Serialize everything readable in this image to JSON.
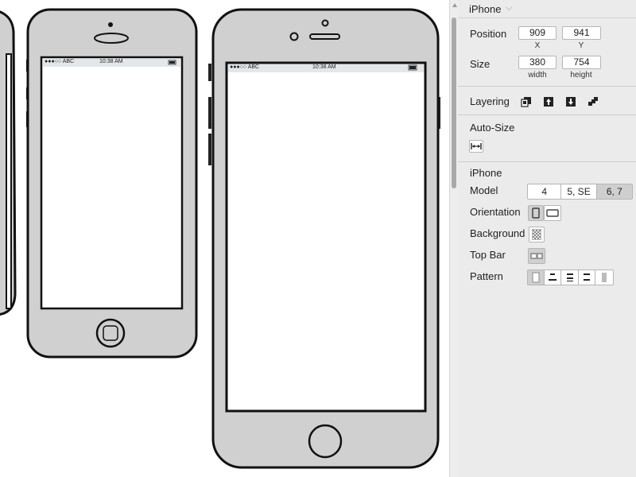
{
  "canvas": {
    "phone_small": {
      "carrier": "●●●○○ ABC",
      "time": "10:38 AM"
    },
    "phone_large": {
      "carrier": "●●●○○ ABC",
      "time": "10:38 AM"
    }
  },
  "panel": {
    "title": "iPhone",
    "position": {
      "label": "Position",
      "x": "909",
      "y": "941",
      "x_caption": "X",
      "y_caption": "Y"
    },
    "size": {
      "label": "Size",
      "width": "380",
      "height": "754",
      "width_caption": "width",
      "height_caption": "height"
    },
    "layering": {
      "label": "Layering",
      "icons": [
        "bring-to-front-icon",
        "bring-forward-icon",
        "send-backward-icon",
        "send-to-back-icon"
      ]
    },
    "autosize": {
      "label": "Auto-Size",
      "icon": "fit-width-icon"
    },
    "section_title": "iPhone",
    "model": {
      "label": "Model",
      "options": [
        "4",
        "5, SE",
        "6, 7"
      ],
      "selected": "6, 7"
    },
    "orientation": {
      "label": "Orientation",
      "options": [
        "portrait",
        "landscape"
      ],
      "selected": "portrait"
    },
    "background": {
      "label": "Background",
      "icon": "checker-pattern-icon"
    },
    "topbar": {
      "label": "Top Bar",
      "icon": "status-bar-icon"
    },
    "pattern": {
      "label": "Pattern",
      "icons": [
        "pattern-blank-icon",
        "pattern-1-icon",
        "pattern-2-icon",
        "pattern-3-icon",
        "pattern-4-icon"
      ]
    }
  }
}
